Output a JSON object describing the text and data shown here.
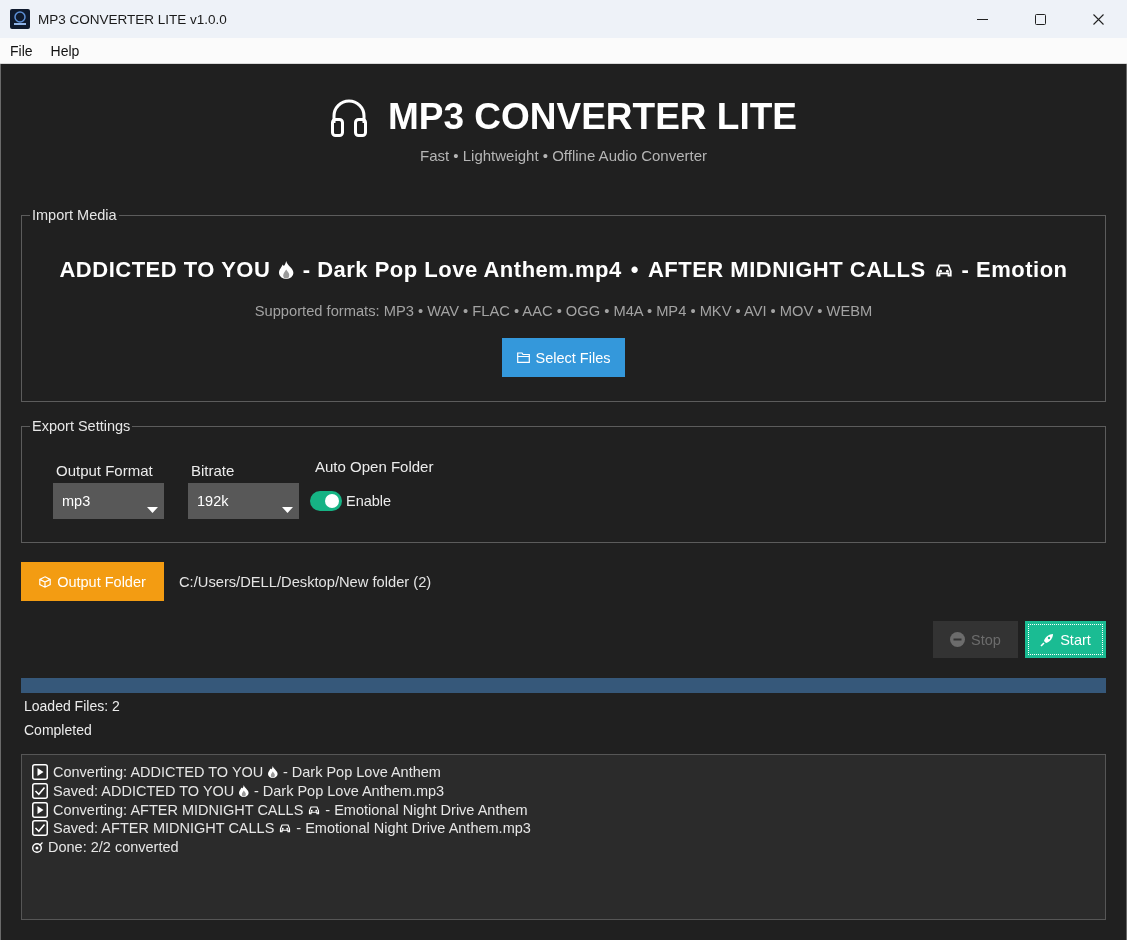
{
  "window": {
    "title": "MP3 CONVERTER LITE v1.0.0"
  },
  "menu": [
    "File",
    "Help"
  ],
  "header": {
    "title": "MP3 CONVERTER LITE",
    "subtitle": "Fast • Lightweight • Offline Audio Converter"
  },
  "import_media": {
    "label": "Import Media",
    "files": [
      {
        "title": "ADDICTED TO YOU",
        "rest": "- Dark Pop Love Anthem.mp4"
      },
      {
        "title": "AFTER MIDNIGHT CALLS",
        "rest": "- Emotion"
      }
    ],
    "separator": "•",
    "formats": "Supported formats: MP3 • WAV • FLAC • AAC • OGG • M4A • MP4 • MKV • AVI • MOV • WEBM",
    "select_button": "Select Files"
  },
  "export_settings": {
    "label": "Export Settings",
    "output_format": {
      "label": "Output Format",
      "value": "mp3"
    },
    "bitrate": {
      "label": "Bitrate",
      "value": "192k"
    },
    "auto_open": {
      "label": "Auto Open Folder",
      "on": true,
      "text": "Enable"
    }
  },
  "output": {
    "button": "Output Folder",
    "path": "C:/Users/DELL/Desktop/New folder (2)"
  },
  "actions": [
    {
      "kind": "stop",
      "label": "Stop",
      "disabled": true,
      "focused": false
    },
    {
      "kind": "start",
      "label": "Start",
      "disabled": false,
      "focused": true
    }
  ],
  "progress": {
    "level": 1
  },
  "status": {
    "loaded": "Loaded Files: 2",
    "state": "Completed"
  },
  "log": [
    {
      "kind": "converting",
      "before": "Converting: ADDICTED TO YOU",
      "after": "- Dark Pop Love Anthem"
    },
    {
      "kind": "saved",
      "before": "Saved: ADDICTED TO YOU",
      "after": "- Dark Pop Love Anthem.mp3"
    },
    {
      "kind": "converting",
      "before": "Converting: AFTER MIDNIGHT CALLS",
      "after": "- Emotional Night Drive Anthem"
    },
    {
      "kind": "saved",
      "before": "Saved: AFTER MIDNIGHT CALLS",
      "after": "- Emotional Night Drive Anthem.mp3"
    },
    {
      "kind": "done",
      "before": "Done: 2/2 converted"
    }
  ]
}
